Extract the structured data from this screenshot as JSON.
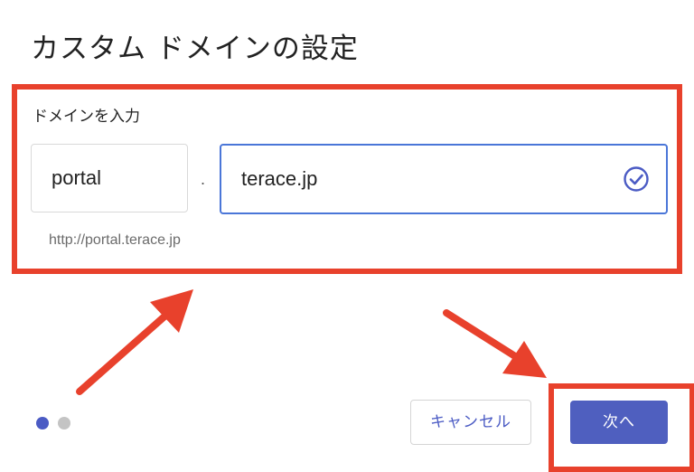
{
  "dialog": {
    "title": "カスタム ドメインの設定"
  },
  "form": {
    "label": "ドメインを入力",
    "subdomain_value": "portal",
    "separator": ".",
    "domain_value": "terace.jp",
    "preview_url": "http://portal.terace.jp"
  },
  "footer": {
    "cancel_label": "キャンセル",
    "next_label": "次へ",
    "step_current": 1,
    "step_total": 2
  },
  "colors": {
    "accent": "#4f5fbf",
    "annotation": "#e8412c",
    "focus_border": "#4a76d8"
  }
}
